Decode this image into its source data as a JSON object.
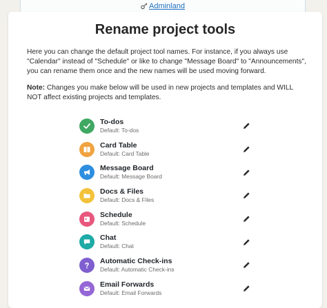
{
  "header": {
    "adminland_label": "Adminland"
  },
  "page": {
    "title": "Rename project tools",
    "intro": "Here you can change the default project tool names. For instance, if you always use \"Calendar\" instead of \"Schedule\" or like to change \"Message Board\" to \"Announcements\", you can rename them once and the new names will be used moving forward.",
    "note_label": "Note:",
    "note_text": " Changes you make below will be used in new projects and templates and WILL NOT affect existing projects and templates."
  },
  "tools": [
    {
      "name": "To-dos",
      "default": "Default: To-dos",
      "icon": "check-icon",
      "color": "#3fa862"
    },
    {
      "name": "Card Table",
      "default": "Default: Card Table",
      "icon": "card-table-icon",
      "color": "#f0a340"
    },
    {
      "name": "Message Board",
      "default": "Default: Message Board",
      "icon": "megaphone-icon",
      "color": "#2e8ee0"
    },
    {
      "name": "Docs & Files",
      "default": "Default: Docs & Files",
      "icon": "folder-icon",
      "color": "#f3c23a"
    },
    {
      "name": "Schedule",
      "default": "Default: Schedule",
      "icon": "calendar-icon",
      "color": "#e8577d"
    },
    {
      "name": "Chat",
      "default": "Default: Chat",
      "icon": "chat-icon",
      "color": "#1eaaa6"
    },
    {
      "name": "Automatic Check-ins",
      "default": "Default: Automatic Check-ins",
      "icon": "question-icon",
      "color": "#7f5fcf"
    },
    {
      "name": "Email Forwards",
      "default": "Default: Email Forwards",
      "icon": "email-icon",
      "color": "#9566d6"
    }
  ]
}
